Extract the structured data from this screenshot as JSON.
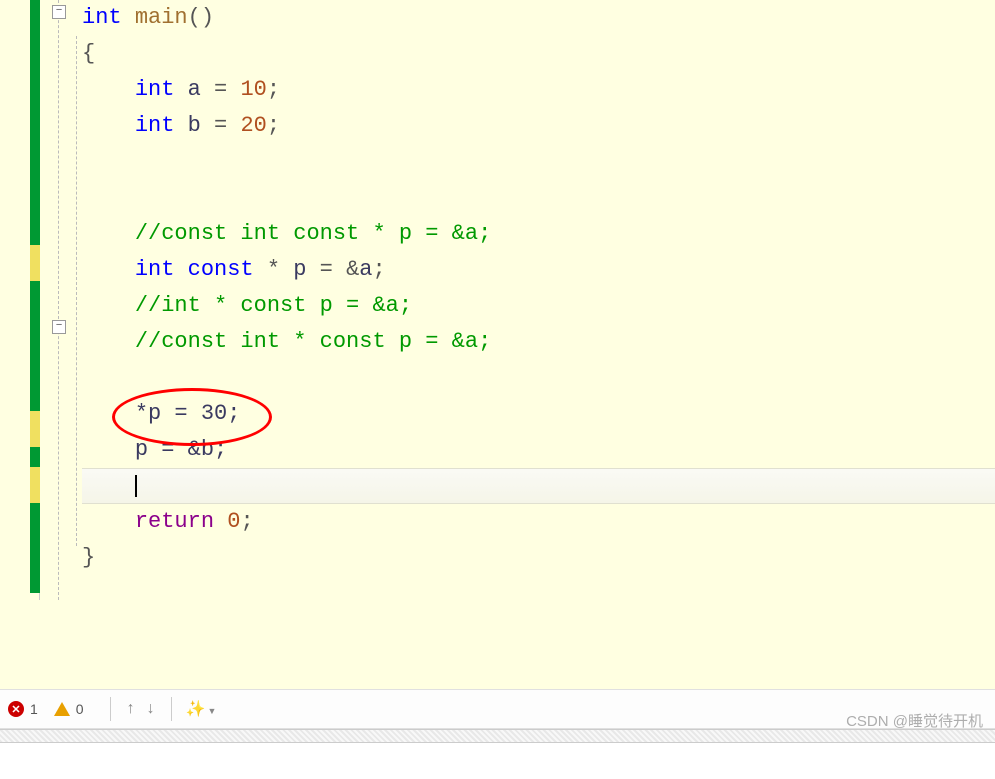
{
  "code": {
    "l1": {
      "kw1": "int",
      "fn": "main",
      "par": "()"
    },
    "l2": {
      "brace": "{"
    },
    "l3": {
      "kw": "int",
      "var": "a",
      "eq": " = ",
      "val": "10",
      "semi": ";"
    },
    "l4": {
      "kw": "int",
      "var": "b",
      "eq": " = ",
      "val": "20",
      "semi": ";"
    },
    "l7": {
      "text": "//const int const * p = &a;"
    },
    "l8": {
      "kw1": "int",
      "kw2": "const",
      "star": " * ",
      "var": "p",
      "eq": " = ",
      "amp": "&",
      "ref": "a",
      "semi": ";"
    },
    "l9": {
      "text": "//int * const p = &a;"
    },
    "l10": {
      "text": "//const int * const p = &a;"
    },
    "l12": {
      "text": "*p = 30;"
    },
    "l13": {
      "text": "p = &b;"
    },
    "l15": {
      "kw": "return",
      "val": "0",
      "semi": ";"
    },
    "l16": {
      "brace": "}"
    }
  },
  "toolbar": {
    "error_count": "1",
    "warning_count": "0"
  },
  "watermark": "CSDN @睡觉待开机",
  "annotation": {
    "circled_line": "*p = 30;"
  }
}
